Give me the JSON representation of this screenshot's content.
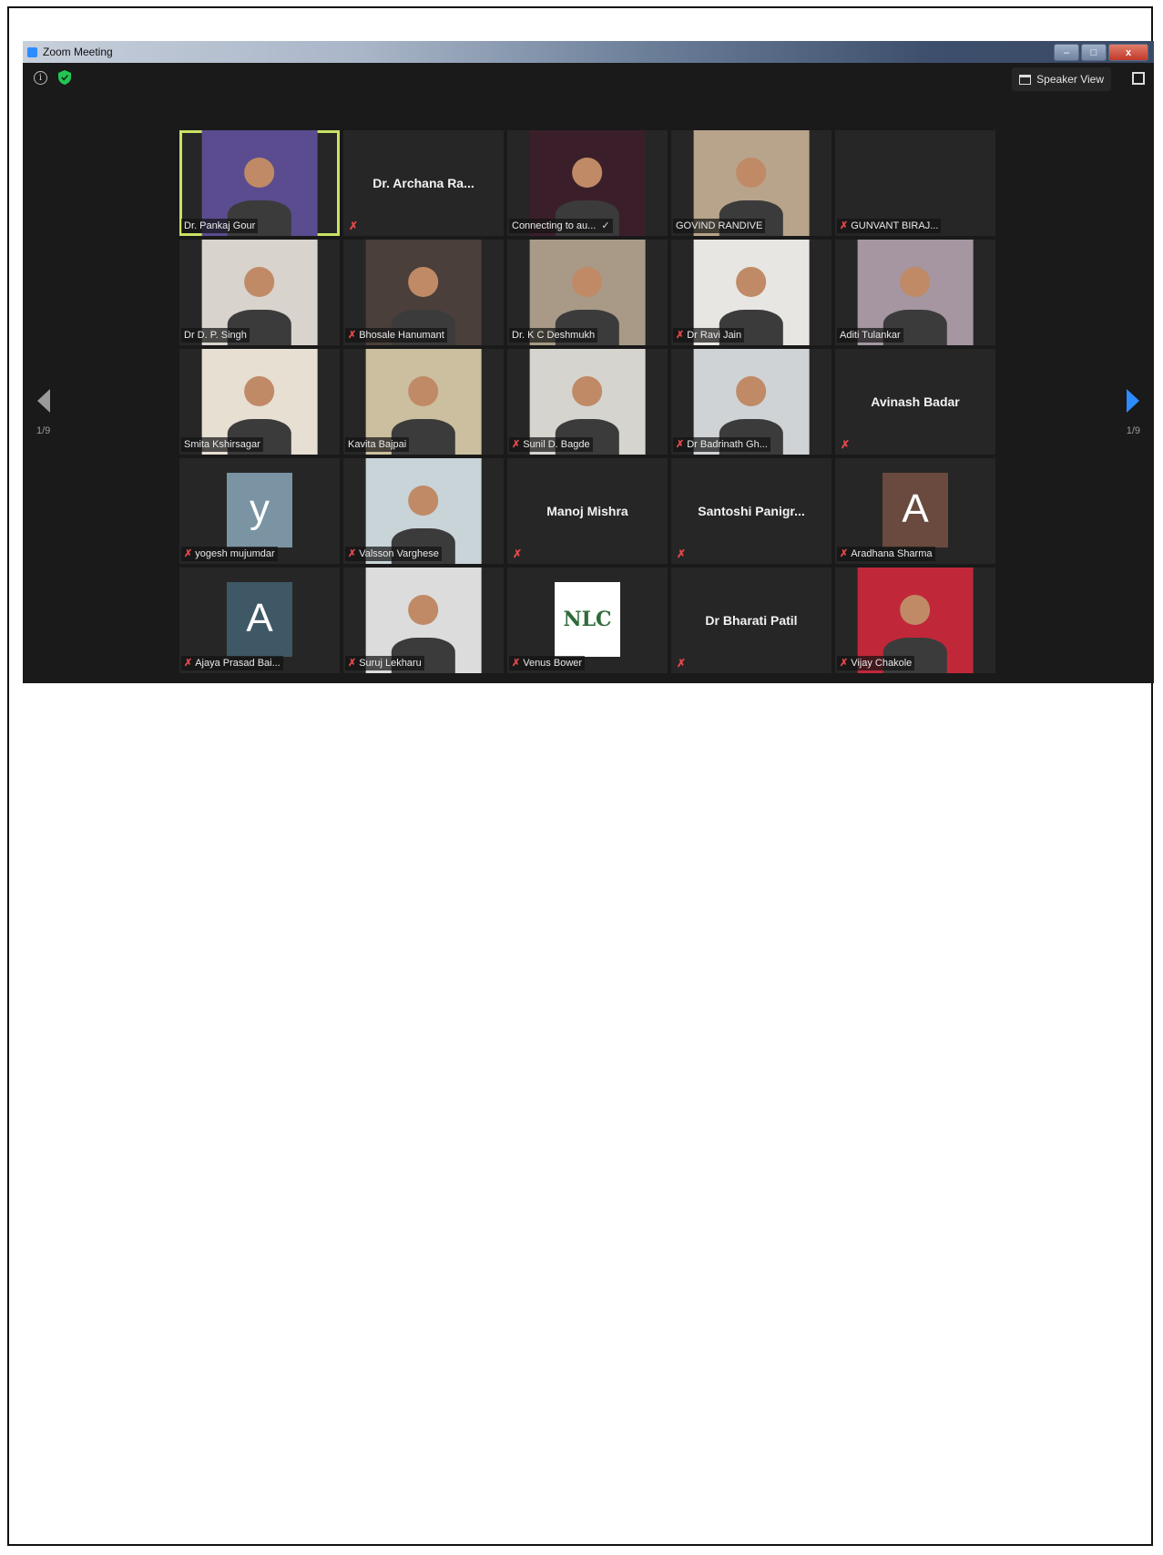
{
  "window": {
    "title": "Zoom Meeting",
    "controls": {
      "minimize": "–",
      "maximize": "□",
      "close": "x"
    }
  },
  "toolbar": {
    "info": "i",
    "speaker_view_label": "Speaker View"
  },
  "pagination": {
    "left": "1/9",
    "right": "1/9"
  },
  "colors": {
    "active_border": "#c9e265",
    "mute": "#e5484d",
    "next_arrow": "#2d8cff"
  },
  "participants": [
    {
      "name": "Dr. Pankaj Gour",
      "muted": false,
      "active": true,
      "bg": "#5a4c8f"
    },
    {
      "name": "Dr. Archana Ra...",
      "muted": true,
      "video": false
    },
    {
      "name": "Connecting to au...",
      "muted": false,
      "connecting": true,
      "bg": "#3a1f2a"
    },
    {
      "name": "GOVIND RANDIVE",
      "muted": false,
      "bg": "#b8a48a"
    },
    {
      "name": "GUNVANT BIRAJ...",
      "muted": true,
      "nothing": true
    },
    {
      "name": "Dr D. P. Singh",
      "muted": false,
      "bg": "#d8d3cc"
    },
    {
      "name": "Bhosale Hanumant",
      "muted": true,
      "bg": "#4a3f3a"
    },
    {
      "name": "Dr. K C Deshmukh",
      "muted": false,
      "bg": "#a89a86"
    },
    {
      "name": "Dr Ravi Jain",
      "muted": true,
      "bg": "#e8e6e2"
    },
    {
      "name": "Aditi Tulankar",
      "muted": false,
      "bg": "#a596a2"
    },
    {
      "name": "Smita Kshirsagar",
      "muted": false,
      "bg": "#e6dfd2"
    },
    {
      "name": "Kavita Bajpai",
      "muted": false,
      "bg": "#cbbf9f"
    },
    {
      "name": "Sunil D. Bagde",
      "muted": true,
      "bg": "#d6d4cf"
    },
    {
      "name": "Dr Badrinath Gh...",
      "muted": true,
      "bg": "#cfd3d6"
    },
    {
      "name": "Avinash Badar",
      "muted": true,
      "video": false
    },
    {
      "name": "yogesh mujumdar",
      "muted": true,
      "letter": "y",
      "bg": "#7a94a3"
    },
    {
      "name": "Valsson Varghese",
      "muted": true,
      "bg": "#c8d4d8"
    },
    {
      "name": "Manoj Mishra",
      "muted": true,
      "video": false
    },
    {
      "name": "Santoshi Panigr...",
      "muted": true,
      "video": false
    },
    {
      "name": "Aradhana Sharma",
      "muted": true,
      "letter": "A",
      "bg": "#6a4a3e"
    },
    {
      "name": "Ajaya Prasad Bai...",
      "muted": true,
      "letter": "A",
      "bg": "#3f5865"
    },
    {
      "name": "Suruj Lekharu",
      "muted": true,
      "bg": "#dcdcdc"
    },
    {
      "name": "Venus Bower",
      "muted": true,
      "logo": "NLC",
      "bg": "#ffffff"
    },
    {
      "name": "Dr Bharati Patil",
      "muted": true,
      "video": false
    },
    {
      "name": "Vijay Chakole",
      "muted": true,
      "bg": "#c0283a"
    }
  ]
}
